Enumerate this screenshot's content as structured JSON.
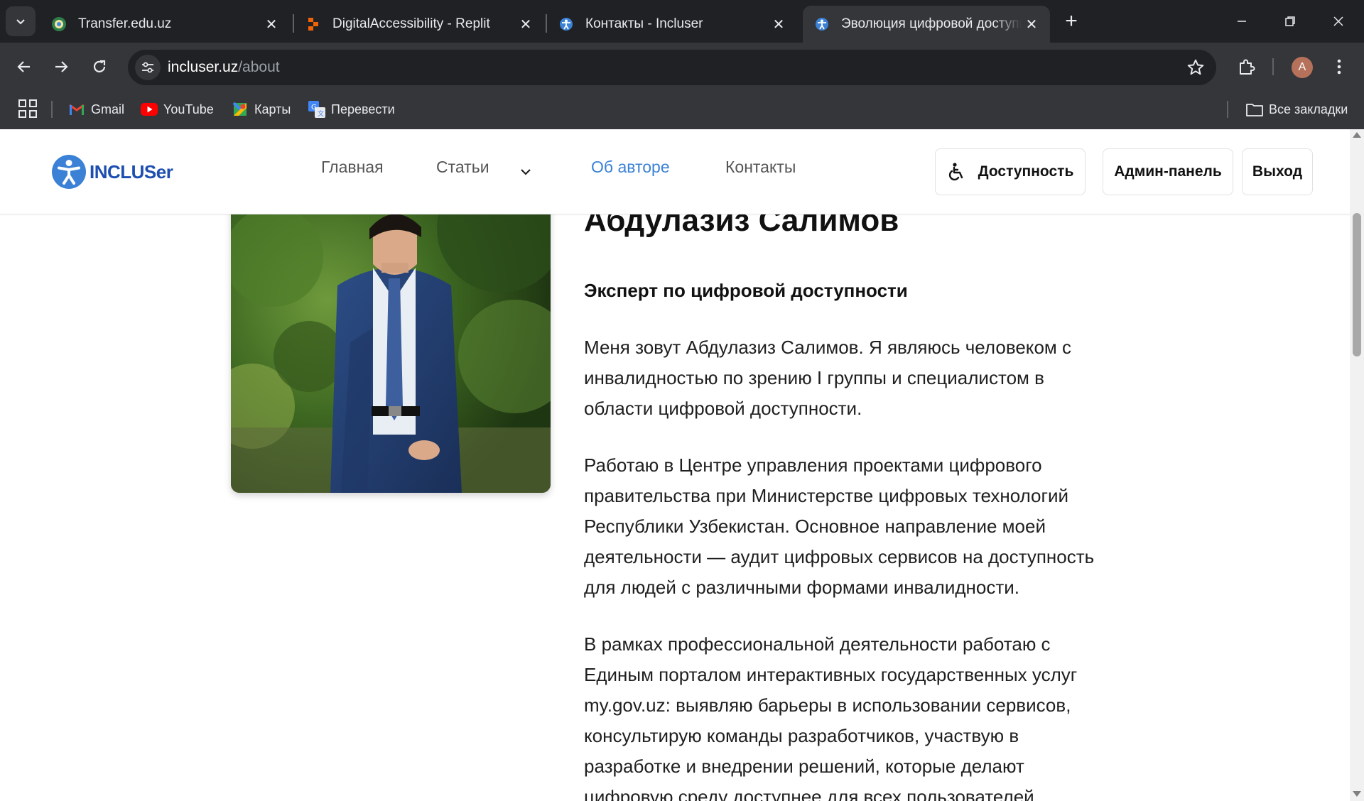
{
  "browser": {
    "tabs": [
      {
        "title": "Transfer.edu.uz",
        "favicon": "emblem-icon"
      },
      {
        "title": "DigitalAccessibility - Replit",
        "favicon": "replit-icon"
      },
      {
        "title": "Контакты - Incluser",
        "favicon": "incluser-icon"
      },
      {
        "title": "Эволюция цифровой доступно",
        "favicon": "incluser-icon",
        "active": true
      }
    ],
    "url_host": "incluser.uz",
    "url_path": "/about",
    "profile_initial": "A",
    "bookmarks": [
      {
        "label": "Gmail",
        "icon": "gmail-icon"
      },
      {
        "label": "YouTube",
        "icon": "youtube-icon"
      },
      {
        "label": "Карты",
        "icon": "maps-icon"
      },
      {
        "label": "Перевести",
        "icon": "translate-icon"
      }
    ],
    "all_bookmarks_label": "Все закладки"
  },
  "site": {
    "logo_text": "INCLUSer",
    "nav": [
      {
        "label": "Главная",
        "active": false
      },
      {
        "label": "Статьи",
        "active": false,
        "has_dropdown": true
      },
      {
        "label": "Об авторе",
        "active": true
      },
      {
        "label": "Контакты",
        "active": false
      }
    ],
    "buttons": {
      "accessibility": "Доступность",
      "admin": "Админ-панель",
      "logout": "Выход"
    },
    "accent_color": "#3b82d6",
    "logo_color": "#1e4fb0"
  },
  "about": {
    "name": "Абдулазиз Салимов",
    "role": "Эксперт по цифровой доступности",
    "paragraphs": [
      "Меня зовут Абдулазиз Салимов. Я являюсь человеком с инвалидностью по зрению I группы и специалистом в области цифровой доступности.",
      "Работаю в Центре управления проектами цифрового правительства при Министерстве цифровых технологий Республики Узбекистан. Основное направление моей деятельности — аудит цифровых сервисов на доступность для людей с различными формами инвалидности.",
      "В рамках профессиональной деятельности работаю с Единым порталом интерактивных государственных услуг my.gov.uz: выявляю барьеры в использовании сервисов, консультирую команды разработчиков, участвую в разработке и внедрении решений, которые делают цифровую среду доступнее для всех пользователей."
    ]
  }
}
